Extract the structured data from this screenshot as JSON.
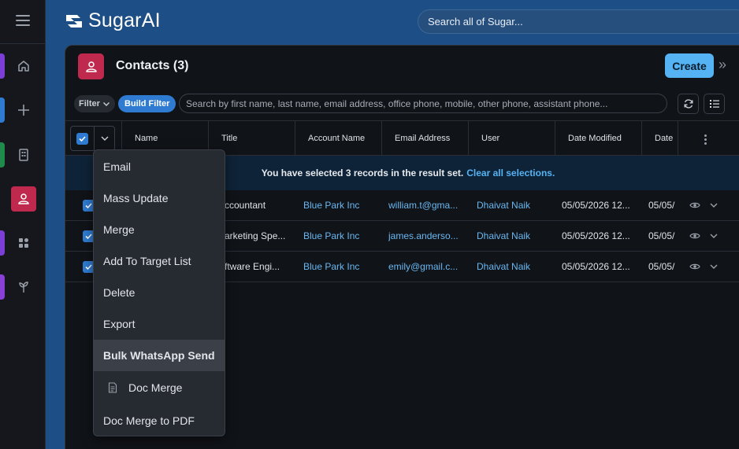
{
  "brand": {
    "name": "SugarAI"
  },
  "global_search": {
    "placeholder": "Search all of Sugar..."
  },
  "rail": {
    "items": [
      "menu-icon",
      "home-icon",
      "plus-icon",
      "building-icon",
      "contacts-icon",
      "dashboard-icon",
      "plant-icon"
    ]
  },
  "module": {
    "title": "Contacts (3)",
    "create_label": "Create",
    "collapse_glyph": "»"
  },
  "toolbar": {
    "filter_label": "Filter",
    "build_filter_label": "Build Filter",
    "search_placeholder": "Search by first name, last name, email address, office phone, mobile, other phone, assistant phone..."
  },
  "table": {
    "columns": [
      "Name",
      "Title",
      "Account Name",
      "Email Address",
      "User",
      "Date Modified",
      "Date"
    ],
    "selection_banner": {
      "text": "You have selected 3 records in the result set.",
      "link": "Clear all selections."
    },
    "rows": [
      {
        "title": "ccountant",
        "account": "Blue Park Inc",
        "email": "william.t@gma...",
        "user": "Dhaivat Naik",
        "modified": "05/05/2026 12...",
        "date": "05/05/"
      },
      {
        "title": "arketing Spe...",
        "account": "Blue Park Inc",
        "email": "james.anderso...",
        "user": "Dhaivat Naik",
        "modified": "05/05/2026 12...",
        "date": "05/05/"
      },
      {
        "title": "ftware Engi...",
        "account": "Blue Park Inc",
        "email": "emily@gmail.c...",
        "user": "Dhaivat Naik",
        "modified": "05/05/2026 12...",
        "date": "05/05/"
      }
    ]
  },
  "actions_menu": {
    "items": [
      "Email",
      "Mass Update",
      "Merge",
      "Add To Target List",
      "Delete",
      "Export",
      "Bulk WhatsApp Send",
      "Doc Merge",
      "Doc Merge to PDF"
    ],
    "highlighted": "Bulk WhatsApp Send"
  },
  "colors": {
    "accent": "#55b3f3",
    "contacts": "#c0294e",
    "primary": "#2f7bd1",
    "background": "#1e4e86"
  }
}
